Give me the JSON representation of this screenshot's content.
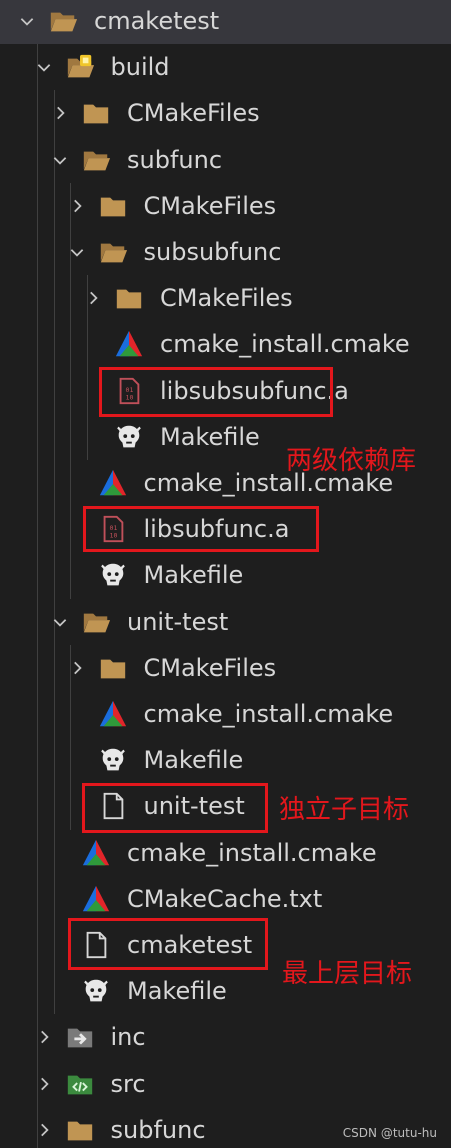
{
  "tree": {
    "items": [
      {
        "label": "cmaketest",
        "kind": "folder-open",
        "level": 0,
        "expanded": true
      },
      {
        "label": "build",
        "kind": "build-folder-open",
        "level": 1,
        "expanded": true
      },
      {
        "label": "CMakeFiles",
        "kind": "folder",
        "level": 2,
        "expanded": false
      },
      {
        "label": "subfunc",
        "kind": "folder-open",
        "level": 2,
        "expanded": true
      },
      {
        "label": "CMakeFiles",
        "kind": "folder",
        "level": 3,
        "expanded": false
      },
      {
        "label": "subsubfunc",
        "kind": "folder-open",
        "level": 3,
        "expanded": true
      },
      {
        "label": "CMakeFiles",
        "kind": "folder",
        "level": 4,
        "expanded": false
      },
      {
        "label": "cmake_install.cmake",
        "kind": "cmake",
        "level": 4
      },
      {
        "label": "libsubsubfunc.a",
        "kind": "binary",
        "level": 4
      },
      {
        "label": "Makefile",
        "kind": "makefile",
        "level": 4
      },
      {
        "label": "cmake_install.cmake",
        "kind": "cmake",
        "level": 3
      },
      {
        "label": "libsubfunc.a",
        "kind": "binary",
        "level": 3
      },
      {
        "label": "Makefile",
        "kind": "makefile",
        "level": 3
      },
      {
        "label": "unit-test",
        "kind": "folder-open",
        "level": 2,
        "expanded": true
      },
      {
        "label": "CMakeFiles",
        "kind": "folder",
        "level": 3,
        "expanded": false
      },
      {
        "label": "cmake_install.cmake",
        "kind": "cmake",
        "level": 3
      },
      {
        "label": "Makefile",
        "kind": "makefile",
        "level": 3
      },
      {
        "label": "unit-test",
        "kind": "file",
        "level": 3
      },
      {
        "label": "cmake_install.cmake",
        "kind": "cmake",
        "level": 2
      },
      {
        "label": "CMakeCache.txt",
        "kind": "cmake",
        "level": 2
      },
      {
        "label": "cmaketest",
        "kind": "file",
        "level": 2
      },
      {
        "label": "Makefile",
        "kind": "makefile",
        "level": 2
      },
      {
        "label": "inc",
        "kind": "inc-folder",
        "level": 1,
        "expanded": false
      },
      {
        "label": "src",
        "kind": "src-folder",
        "level": 1,
        "expanded": false
      },
      {
        "label": "subfunc",
        "kind": "folder",
        "level": 1,
        "expanded": false
      }
    ]
  },
  "annotations": {
    "two_level_libs": "两级依赖库",
    "standalone_target": "独立子目标",
    "top_target": "最上层目标"
  },
  "watermark": "CSDN @tutu-hu",
  "colors": {
    "background": "#1e1e1e",
    "selected_row": "#37373d",
    "folder": "#c09553",
    "highlight": "#e3171c",
    "text": "#d7d7d7"
  }
}
